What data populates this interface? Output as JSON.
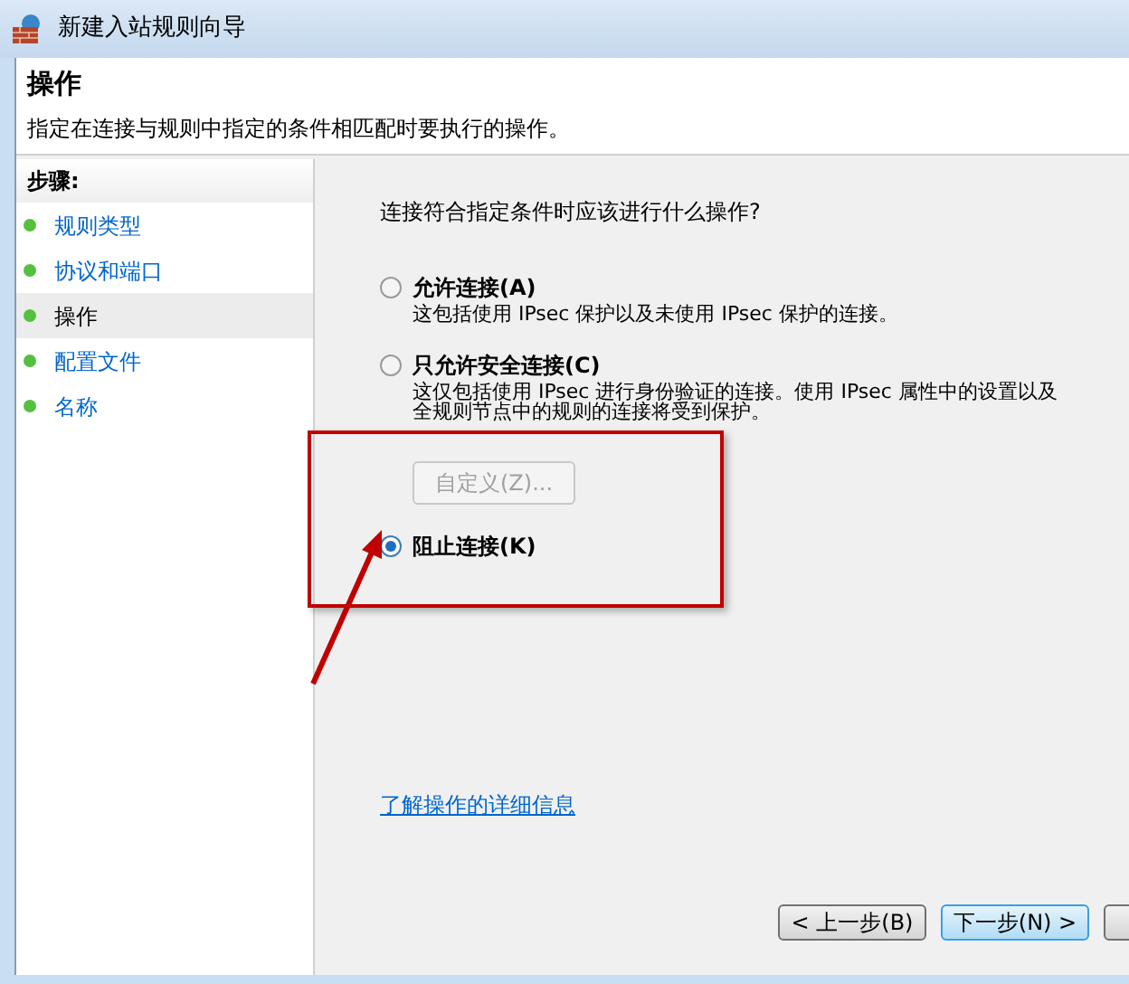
{
  "window": {
    "title": "新建入站规则向导"
  },
  "header": {
    "title": "操作",
    "description": "指定在连接与规则中指定的条件相匹配时要执行的操作。"
  },
  "sidebar": {
    "heading": "步骤:",
    "items": [
      {
        "label": "规则类型",
        "selected": false
      },
      {
        "label": "协议和端口",
        "selected": false
      },
      {
        "label": "操作",
        "selected": true
      },
      {
        "label": "配置文件",
        "selected": false
      },
      {
        "label": "名称",
        "selected": false
      }
    ]
  },
  "question": "连接符合指定条件时应该进行什么操作?",
  "options": [
    {
      "kind": "radio",
      "label": "允许连接(A)",
      "selected": false,
      "description": [
        "这包括使用 IPsec 保护以及未使用 IPsec 保护的连接。"
      ]
    },
    {
      "kind": "radio",
      "label": "只允许安全连接(C)",
      "selected": false,
      "description": [
        "这仅包括使用 IPsec 进行身份验证的连接。使用 IPsec 属性中的设置以及",
        "全规则节点中的规则的连接将受到保护。"
      ]
    },
    {
      "kind": "button",
      "label": "自定义(Z)...",
      "disabled": true
    },
    {
      "kind": "radio",
      "label": "阻止连接(K)",
      "selected": true
    }
  ],
  "help_link": "了解操作的详细信息",
  "buttons": [
    {
      "label": "< 上一步(B)",
      "default": false
    },
    {
      "label": "下一步(N) >",
      "default": true
    }
  ]
}
